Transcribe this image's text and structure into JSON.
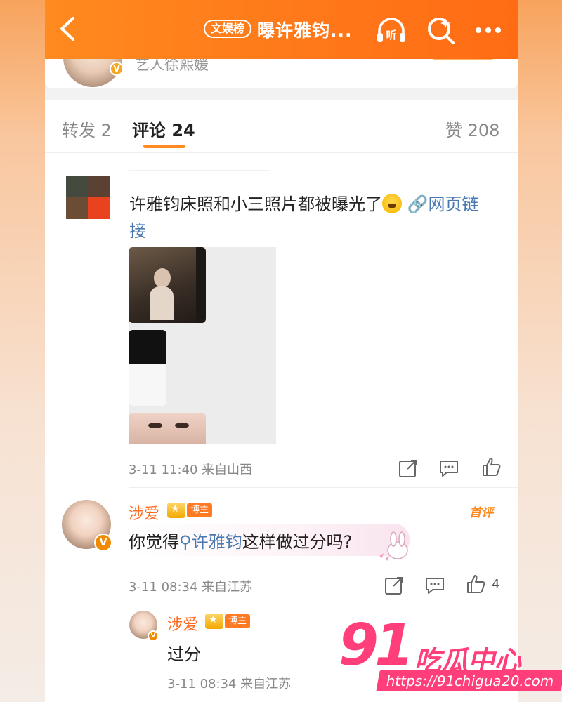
{
  "nav": {
    "tag": "文娱榜",
    "title": "曝许雅钧...",
    "listen_label": "听"
  },
  "header": {
    "author": "艺人徐熙媛"
  },
  "tabs": [
    {
      "label": "转发 2"
    },
    {
      "label": "评论 24"
    },
    {
      "label": "赞 208"
    }
  ],
  "post": {
    "text": "许雅钧床照和小三照片都被曝光了",
    "link_text": "网页链接",
    "time_source": "3-11 11:40  来自山西"
  },
  "comment": {
    "username": "涉爱",
    "badge": "博主",
    "first_tag": "首评",
    "text_before": "你觉得",
    "topic": "许雅钧",
    "text_after": "这样做过分吗?",
    "time_source": "3-11 08:34  来自江苏",
    "like_count": "4"
  },
  "reply": {
    "username": "涉爱",
    "badge": "博主",
    "text": "过分",
    "time_source": "3-11 08:34  来自江苏"
  },
  "watermark": {
    "number": "91",
    "text": "吃瓜中心",
    "url": "https://91chigua20.com"
  },
  "colors": {
    "nav_orange": "#ff7a1a",
    "accent": "#ff8a1f",
    "link_blue": "#4a78b0",
    "username_orange": "#ff6b22",
    "watermark_pink": "#ff3e7a"
  }
}
